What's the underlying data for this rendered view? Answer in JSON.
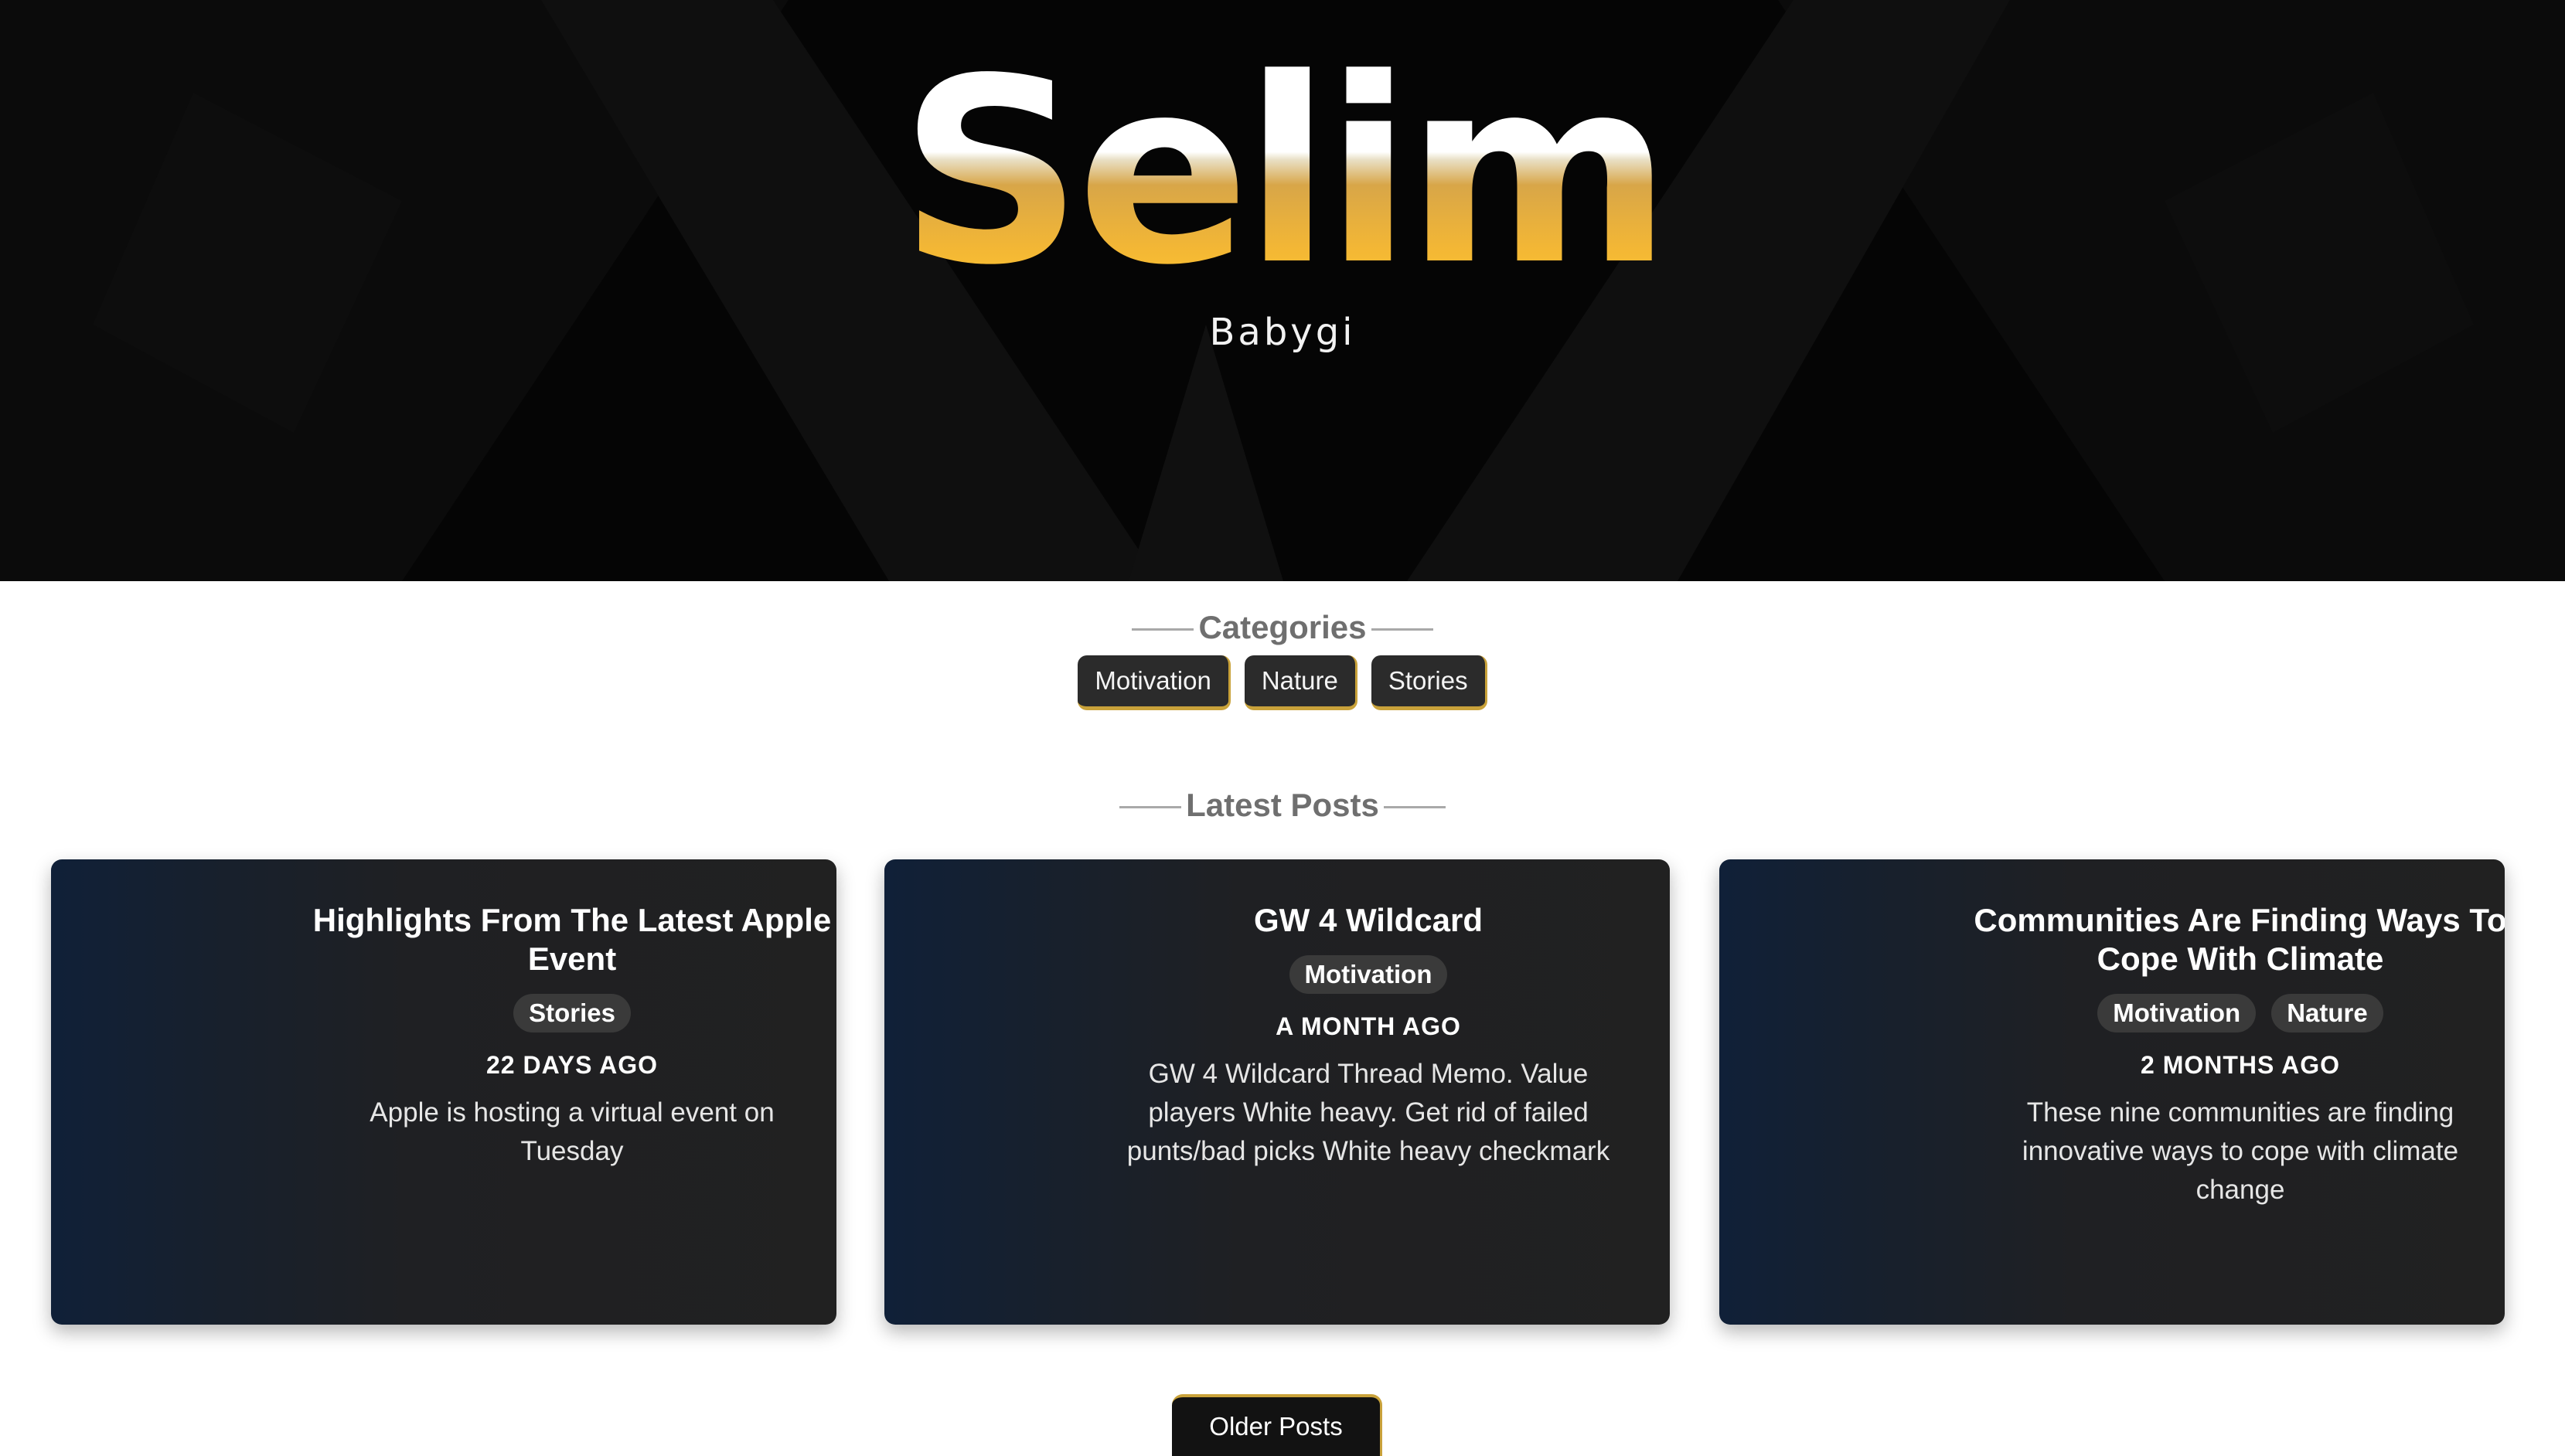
{
  "hero": {
    "title": "Selim",
    "subtitle": "Babygi"
  },
  "categories": {
    "heading": "Categories",
    "items": [
      {
        "label": "Motivation"
      },
      {
        "label": "Nature"
      },
      {
        "label": "Stories"
      }
    ]
  },
  "latest_posts": {
    "heading": "Latest Posts",
    "posts": [
      {
        "title": "Highlights From The Latest Apple Event",
        "tags": [
          "Stories"
        ],
        "date": "22 DAYS AGO",
        "excerpt": "Apple is hosting a virtual event on Tuesday"
      },
      {
        "title": "GW 4 Wildcard",
        "tags": [
          "Motivation"
        ],
        "date": "A MONTH AGO",
        "excerpt": "GW 4 Wildcard Thread Memo. Value players White heavy. Get rid of failed punts/bad picks White heavy checkmark"
      },
      {
        "title": "Communities Are Finding Ways To Cope With Climate",
        "tags": [
          "Motivation",
          "Nature"
        ],
        "date": "2 MONTHS AGO",
        "excerpt": "These nine communities are finding innovative ways to cope with climate change"
      }
    ]
  },
  "pagination": {
    "older_label": "Older Posts"
  },
  "colors": {
    "accent": "#c9a23a",
    "hero_bg": "#050505",
    "card_bg": "#212121",
    "card_gradient_start": "#102038"
  }
}
